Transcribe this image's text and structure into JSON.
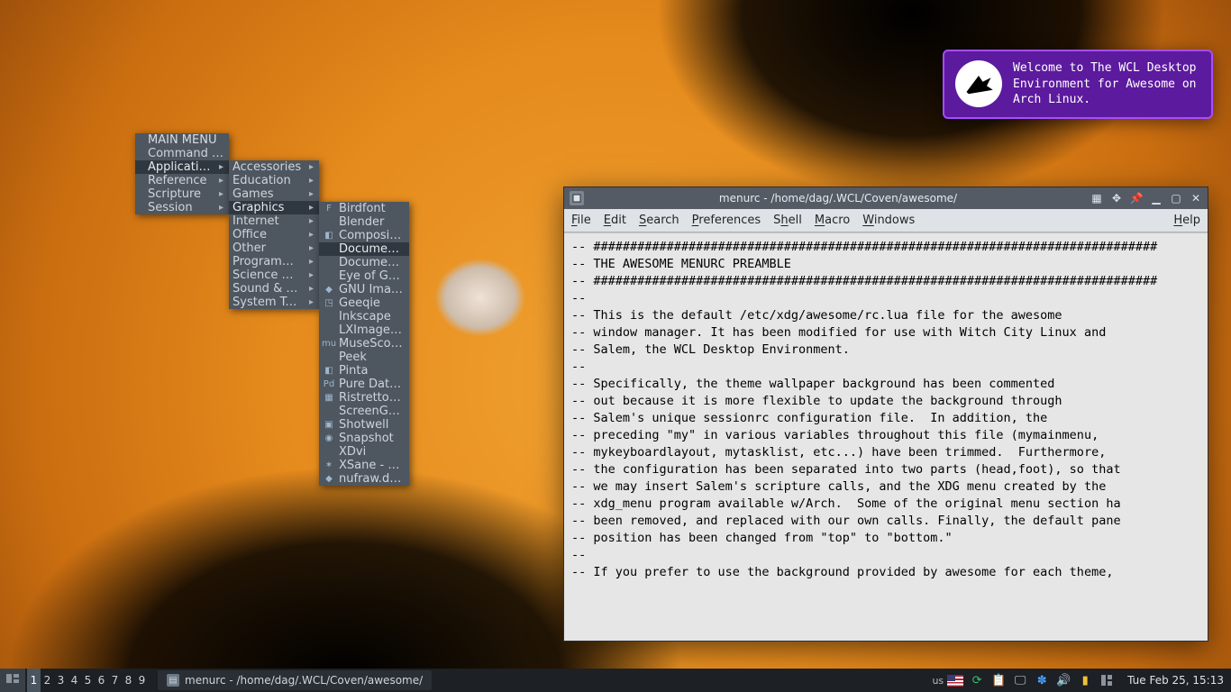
{
  "wallpaper_alt": "Witch with black hat and black cat — Witch City Linux wallpaper",
  "notification": {
    "text": "Welcome to The WCL Desktop Environment for Awesome on Arch Linux.",
    "icon_name": "witch-logo-icon"
  },
  "menu1": {
    "header": "MAIN MENU",
    "items": [
      {
        "label": "Command Line",
        "submenu": false
      },
      {
        "label": "Applications",
        "submenu": true,
        "selected": true
      },
      {
        "label": "Reference",
        "submenu": true
      },
      {
        "label": "Scripture",
        "submenu": true
      },
      {
        "label": "Session",
        "submenu": true
      }
    ]
  },
  "menu2": {
    "items": [
      {
        "label": "Accessories",
        "submenu": true
      },
      {
        "label": "Education",
        "submenu": true
      },
      {
        "label": "Games",
        "submenu": true
      },
      {
        "label": "Graphics",
        "submenu": true,
        "selected": true
      },
      {
        "label": "Internet",
        "submenu": true
      },
      {
        "label": "Office",
        "submenu": true
      },
      {
        "label": "Other",
        "submenu": true
      },
      {
        "label": "Programming",
        "submenu": true
      },
      {
        "label": "Science & Math",
        "submenu": true
      },
      {
        "label": "Sound & Video",
        "submenu": true
      },
      {
        "label": "System Tools",
        "submenu": true
      }
    ]
  },
  "menu3": {
    "items": [
      {
        "label": "Birdfont",
        "icon": "F"
      },
      {
        "label": "Blender"
      },
      {
        "label": "Compositor O…",
        "icon": "◧"
      },
      {
        "label": "Document Sca…",
        "selected": true
      },
      {
        "label": "Document Vie…"
      },
      {
        "label": "Eye of GNOME"
      },
      {
        "label": "GNU Image M…",
        "icon": "◆"
      },
      {
        "label": "Geeqie",
        "icon": "◳"
      },
      {
        "label": "Inkscape"
      },
      {
        "label": "LXImage-Qt"
      },
      {
        "label": "MuseScore Stu…",
        "icon": "mu"
      },
      {
        "label": "Peek"
      },
      {
        "label": "Pinta",
        "icon": "◧"
      },
      {
        "label": "Pure Data (Pd)",
        "icon": "Pd"
      },
      {
        "label": "Ristretto Imag…",
        "icon": "▦"
      },
      {
        "label": "ScreenGrab"
      },
      {
        "label": "Shotwell",
        "icon": "▣"
      },
      {
        "label": "Snapshot",
        "icon": "◉"
      },
      {
        "label": "XDvi"
      },
      {
        "label": "XSane - Scanni…",
        "icon": "✶"
      },
      {
        "label": "nufraw.desktop",
        "icon": "◆"
      }
    ]
  },
  "editor": {
    "title": "menurc - /home/dag/.WCL/Coven/awesome/",
    "menubar": [
      "File",
      "Edit",
      "Search",
      "Preferences",
      "Shell",
      "Macro",
      "Windows",
      "Help"
    ],
    "text": "-- #############################################################################\n-- THE AWESOME MENURC PREAMBLE\n-- #############################################################################\n--\n-- This is the default /etc/xdg/awesome/rc.lua file for the awesome\n-- window manager. It has been modified for use with Witch City Linux and\n-- Salem, the WCL Desktop Environment.\n--\n-- Specifically, the theme wallpaper background has been commented\n-- out because it is more flexible to update the background through\n-- Salem's unique sessionrc configuration file.  In addition, the\n-- preceding \"my\" in various variables throughout this file (mymainmenu,\n-- mykeyboardlayout, mytasklist, etc...) have been trimmed.  Furthermore,\n-- the configuration has been separated into two parts (head,foot), so that\n-- we may insert Salem's scripture calls, and the XDG menu created by the\n-- xdg_menu program available w/Arch.  Some of the original menu section ha\n-- been removed, and replaced with our own calls. Finally, the default pane\n-- position has been changed from \"top\" to \"bottom.\"\n--\n-- If you prefer to use the background provided by awesome for each theme,"
  },
  "panel": {
    "tags": [
      "1",
      "2",
      "3",
      "4",
      "5",
      "6",
      "7",
      "8",
      "9"
    ],
    "active_tag_index": 0,
    "task_title": "menurc - /home/dag/.WCL/Coven/awesome/",
    "kb_layout": "us",
    "clock": "Tue Feb 25, 15:13",
    "tray_icons": [
      "flag",
      "loop",
      "clipboard",
      "monitor",
      "bluetooth",
      "volume",
      "battery",
      "layout"
    ]
  }
}
